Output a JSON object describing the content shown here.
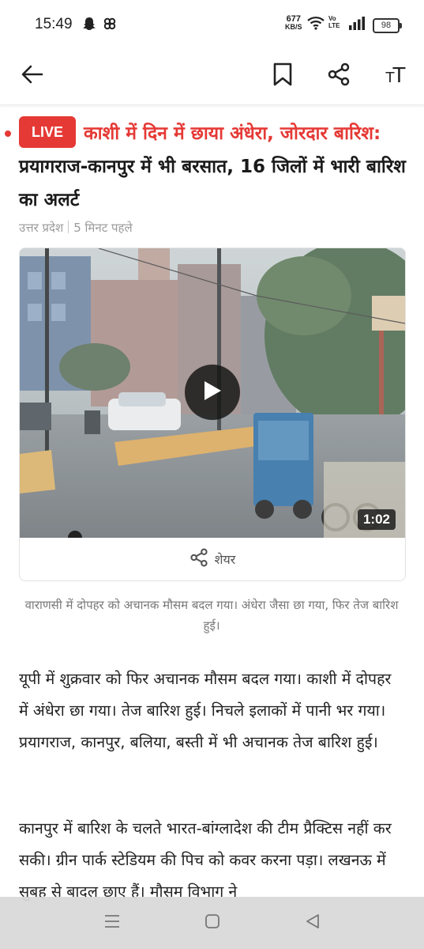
{
  "status_bar": {
    "time": "15:49",
    "net_speed": "677",
    "net_unit": "KB/S",
    "volte": "Vo\nLTE",
    "battery": "98"
  },
  "app_bar": {
    "back_icon": "arrow-left-icon",
    "bookmark_icon": "bookmark-icon",
    "share_icon": "share-icon",
    "text_size_label": "TT"
  },
  "article": {
    "live_label": "LIVE",
    "headline_highlight": "काशी में दिन में छाया अंधेरा, जोरदार बारिश:",
    "headline_rest": " प्रयागराज-कानपुर में भी बरसात, 16 जिलों में भारी बारिश का अलर्ट",
    "category": "उत्तर प्रदेश",
    "time_ago": "5 मिनट पहले",
    "video_duration": "1:02",
    "share_label": "शेयर",
    "caption": "वाराणसी में दोपहर को अचानक मौसम बदल गया। अंधेरा जैसा छा गया, फिर तेज बारिश हुई।",
    "paragraphs": [
      "यूपी में शुक्रवार को फिर अचानक मौसम बदल गया। काशी में दोपहर में अंधेरा छा गया। तेज बारिश हुई। निचले इलाकों में पानी भर गया। प्रयागराज, कानपुर, बलिया, बस्ती में भी अचानक तेज बारिश हुई।",
      "कानपुर में बारिश के चलते भारत-बांग्लादेश की टीम प्रैक्टिस नहीं कर सकी। ग्रीन पार्क स्टेडियम की पिच को कवर करना पड़ा। लखनऊ में सुबह से बादल छाए हैं। मौसम विभाग ने"
    ]
  },
  "colors": {
    "accent": "#e53935",
    "text": "#1a1a1a",
    "muted": "#9a9a9a"
  },
  "nav_bar": {
    "menu_icon": "menu-icon",
    "home_icon": "home-square-icon",
    "back_icon": "back-triangle-icon"
  }
}
